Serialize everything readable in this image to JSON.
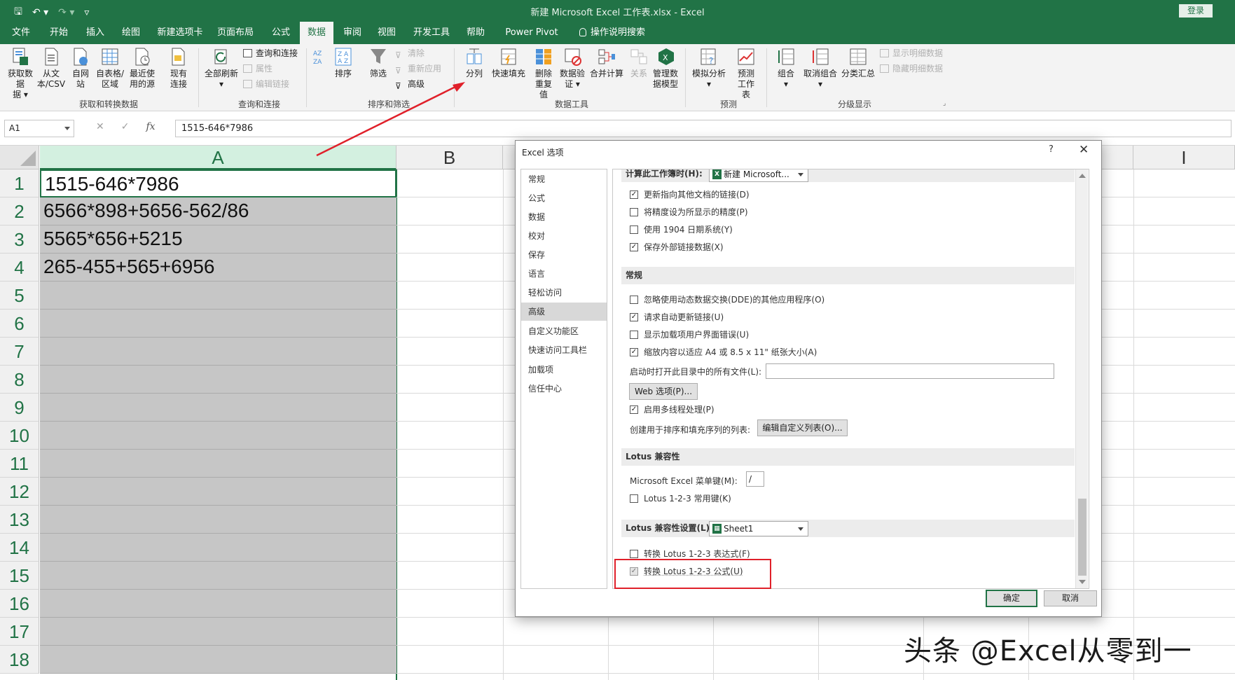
{
  "window": {
    "title": "新建 Microsoft Excel 工作表.xlsx  -  Excel",
    "login_label": "登录",
    "qat": {
      "save_icon": "save-icon",
      "undo_icon": "undo-icon",
      "redo_icon": "redo-icon"
    }
  },
  "tabs": [
    {
      "label": "文件"
    },
    {
      "label": "开始"
    },
    {
      "label": "插入"
    },
    {
      "label": "绘图"
    },
    {
      "label": "新建选项卡"
    },
    {
      "label": "页面布局"
    },
    {
      "label": "公式"
    },
    {
      "label": "数据"
    },
    {
      "label": "审阅"
    },
    {
      "label": "视图"
    },
    {
      "label": "开发工具"
    },
    {
      "label": "帮助"
    },
    {
      "label": "Power Pivot"
    },
    {
      "label": "操作说明搜索"
    }
  ],
  "ribbon": {
    "get_data": {
      "btn1": "获取数据",
      "btn1b": "据 ▾",
      "btn2": "从文本/CSV",
      "btn3": "自网站",
      "btn4": "自表格/区域",
      "btn5": "最近使用的源",
      "btn6": "现有连接",
      "group": "获取和转换数据"
    },
    "queries": {
      "refresh_all": "全部刷新",
      "queries_conn": "查询和连接",
      "properties": "属性",
      "edit_links": "编辑链接",
      "group": "查询和连接"
    },
    "sort": {
      "sort": "排序",
      "filter": "筛选",
      "clear": "清除",
      "reapply": "重新应用",
      "advanced": "高级",
      "group": "排序和筛选"
    },
    "tools": {
      "split": "分列",
      "flash_fill": "快速填充",
      "remove_dup": "删除重复值",
      "validate": "数据验证 ▾",
      "consolidate": "合并计算",
      "relations": "关系",
      "manage_model": "管理数据模型",
      "group": "数据工具"
    },
    "forecast": {
      "what_if": "模拟分析",
      "forecast_sheet": "预测工作表",
      "group": "预测"
    },
    "outline": {
      "group_btn": "组合",
      "ungroup": "取消组合",
      "subtotal": "分类汇总",
      "show_detail": "显示明细数据",
      "hide_detail": "隐藏明细数据",
      "group": "分级显示"
    }
  },
  "formula_bar": {
    "name_box": "A1",
    "formula": "1515-646*7986"
  },
  "sheet": {
    "columns": [
      "A",
      "B",
      "I"
    ],
    "rows": [
      "1",
      "2",
      "3",
      "4",
      "5",
      "6",
      "7",
      "8",
      "9",
      "10",
      "11",
      "12",
      "13",
      "14",
      "15",
      "16",
      "17",
      "18"
    ],
    "cells": [
      "1515-646*7986",
      "6566*898+5656-562/86",
      "5565*656+5215",
      "265-455+565+6956"
    ]
  },
  "dialog": {
    "title": "Excel 选项",
    "help": "?",
    "close": "✕",
    "nav": [
      "常规",
      "公式",
      "数据",
      "校对",
      "保存",
      "语言",
      "轻松访问",
      "高级",
      "自定义功能区",
      "快速访问工具栏",
      "加载项",
      "信任中心"
    ],
    "nav_selected": "高级",
    "calc_header": "计算此工作簿时(H):",
    "calc_workbook": "新建 Microsoft...",
    "calc_options": [
      {
        "label": "更新指向其他文档的链接(D)",
        "checked": true
      },
      {
        "label": "将精度设为所显示的精度(P)",
        "checked": false
      },
      {
        "label": "使用 1904 日期系统(Y)",
        "checked": false
      },
      {
        "label": "保存外部链接数据(X)",
        "checked": true
      }
    ],
    "general_header": "常规",
    "general_options": [
      {
        "label": "忽略使用动态数据交换(DDE)的其他应用程序(O)",
        "checked": false
      },
      {
        "label": "请求自动更新链接(U)",
        "checked": true
      },
      {
        "label": "显示加载项用户界面错误(U)",
        "checked": false
      },
      {
        "label": "缩放内容以适应 A4 或 8.5 x 11\" 纸张大小(A)",
        "checked": true
      }
    ],
    "startup_label": "启动时打开此目录中的所有文件(L):",
    "web_options": "Web 选项(P)...",
    "multithread": {
      "label": "启用多线程处理(P)",
      "checked": true
    },
    "custom_list_label": "创建用于排序和填充序列的列表:",
    "edit_custom_lists": "编辑自定义列表(O)...",
    "lotus_header": "Lotus 兼容性",
    "menu_key_label": "Microsoft Excel 菜单键(M):",
    "menu_key_value": "/",
    "lotus_nav": {
      "label": "Lotus 1-2-3 常用键(K)",
      "checked": false
    },
    "lotus_settings_header": "Lotus 兼容性设置(L):",
    "lotus_sheet": "Sheet1",
    "lotus_expr": {
      "label": "转换 Lotus 1-2-3 表达式(F)",
      "checked": false
    },
    "lotus_formula": {
      "label": "转换 Lotus 1-2-3 公式(U)",
      "checked": true
    },
    "ok": "确定",
    "cancel": "取消"
  },
  "watermark": "头条 @Excel从零到一",
  "colors": {
    "accent": "#217346",
    "annotation_red": "#e0202a",
    "selection_gray": "#c6c6c6"
  }
}
